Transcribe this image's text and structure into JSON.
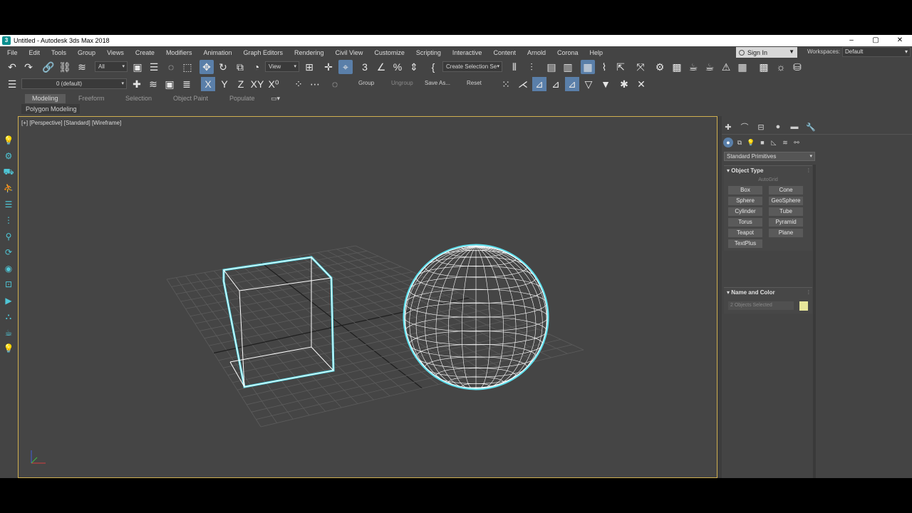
{
  "window": {
    "title": "Untitled - Autodesk 3ds Max 2018",
    "logo_text": "3",
    "controls": [
      "–",
      "▢",
      "✕"
    ]
  },
  "menu": {
    "items": [
      "File",
      "Edit",
      "Tools",
      "Group",
      "Views",
      "Create",
      "Modifiers",
      "Animation",
      "Graph Editors",
      "Rendering",
      "Civil View",
      "Customize",
      "Scripting",
      "Interactive",
      "Content",
      "Arnold",
      "Corona",
      "Help"
    ],
    "sign_in": "Sign In",
    "workspaces_label": "Workspaces:",
    "workspace_value": "Default"
  },
  "toolbar1": {
    "selection_filter": "All",
    "reference_coord": "View",
    "named_selection": "Create Selection Se"
  },
  "toolbar2": {
    "layer": "0 (default)",
    "axis_x": "X",
    "axis_y": "Y",
    "axis_z": "Z",
    "axis_xy": "XY",
    "axis_xp": "X⁰",
    "group": "Group",
    "ungroup": "Ungroup",
    "save_as": "Save As...",
    "reset": "Reset"
  },
  "ribbon": {
    "tabs": [
      "Modeling",
      "Freeform",
      "Selection",
      "Object Paint",
      "Populate"
    ],
    "active_tab": "Modeling",
    "sub_label": "Polygon Modeling"
  },
  "viewport": {
    "label": "[+] [Perspective] [Standard] [Wireframe]",
    "selection_color": "#5fe0ee",
    "wire_color": "#ffffff",
    "grid_color": "#5c5c5c"
  },
  "command_panel": {
    "category": "Standard Primitives",
    "object_type_title": "Object Type",
    "autogrid": "AutoGrid",
    "primitives": [
      "Box",
      "Cone",
      "Sphere",
      "GeoSphere",
      "Cylinder",
      "Tube",
      "Torus",
      "Pyramid",
      "Teapot",
      "Plane",
      "TextPlus"
    ],
    "name_color_title": "Name and Color",
    "name_field": "2 Objects Selected",
    "swatch_color": "#e7e69a"
  }
}
